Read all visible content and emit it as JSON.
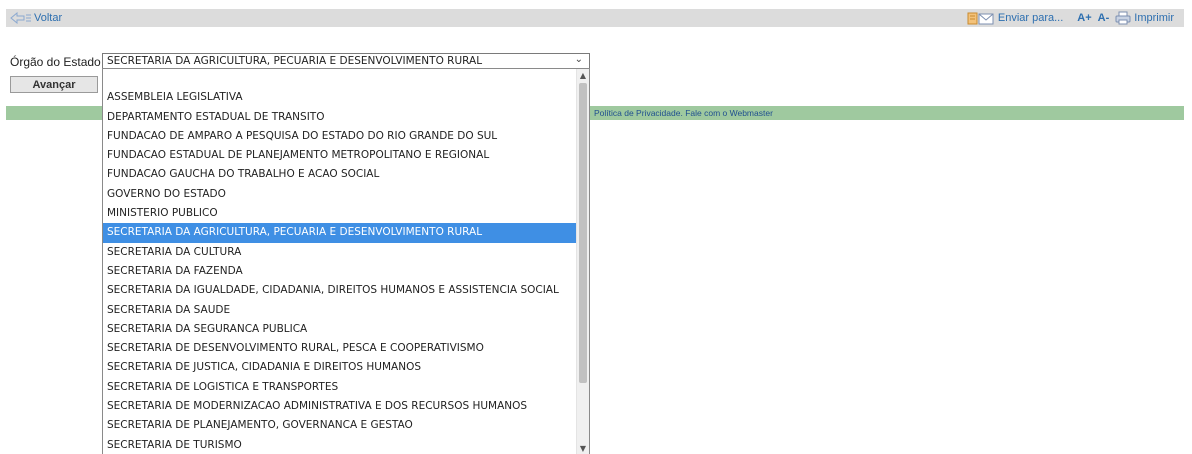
{
  "topbar": {
    "back_label": "Voltar",
    "send_label": "Enviar para...",
    "font_increase": "A+",
    "font_decrease": "A-",
    "print_label": "Imprimir"
  },
  "form": {
    "label": "Órgão do Estado",
    "selected_value": "SECRETARIA DA AGRICULTURA, PECUARIA E DESENVOLVIMENTO RURAL",
    "submit_label": "Avançar"
  },
  "footer": {
    "privacy_label": "Política de Privacidade.",
    "contact_label": "Fale com o Webmaster"
  },
  "dropdown": {
    "options": [
      "",
      "ASSEMBLEIA LEGISLATIVA",
      "DEPARTAMENTO ESTADUAL DE TRANSITO",
      "FUNDACAO DE AMPARO A PESQUISA DO ESTADO DO RIO GRANDE DO SUL",
      "FUNDACAO ESTADUAL DE PLANEJAMENTO METROPOLITANO E REGIONAL",
      "FUNDACAO GAUCHA DO TRABALHO E ACAO SOCIAL",
      "GOVERNO DO ESTADO",
      "MINISTERIO PUBLICO",
      "SECRETARIA DA AGRICULTURA, PECUARIA E DESENVOLVIMENTO RURAL",
      "SECRETARIA DA CULTURA",
      "SECRETARIA DA FAZENDA",
      "SECRETARIA DA IGUALDADE, CIDADANIA, DIREITOS HUMANOS E ASSISTENCIA SOCIAL",
      "SECRETARIA DA SAUDE",
      "SECRETARIA DA SEGURANCA PUBLICA",
      "SECRETARIA DE DESENVOLVIMENTO RURAL, PESCA E COOPERATIVISMO",
      "SECRETARIA DE JUSTICA, CIDADANIA E DIREITOS HUMANOS",
      "SECRETARIA DE LOGISTICA E TRANSPORTES",
      "SECRETARIA DE MODERNIZACAO ADMINISTRATIVA E DOS RECURSOS HUMANOS",
      "SECRETARIA DE PLANEJAMENTO, GOVERNANCA E GESTAO",
      "SECRETARIA DE TURISMO"
    ],
    "selected_index": 8
  },
  "colors": {
    "link": "#2d6fb0",
    "selected_option": "#3f8fe4",
    "footer_bar": "#9fc99f",
    "top_bar": "#dcdcdc"
  },
  "icons": {
    "back": "back-arrow-icon",
    "send": "email-icon",
    "print": "printer-icon",
    "select": "chevron-down-icon"
  }
}
